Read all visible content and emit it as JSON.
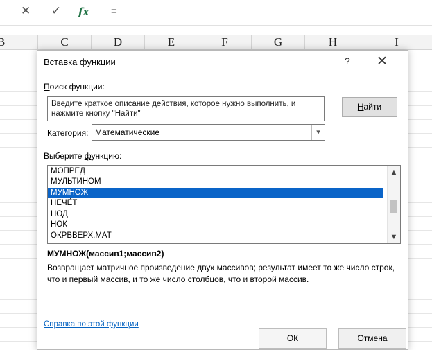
{
  "formula_bar": {
    "cancel_icon": "✕",
    "enter_icon": "✓",
    "fx_label": "fx",
    "formula": "="
  },
  "columns": [
    "B",
    "C",
    "D",
    "E",
    "F",
    "G",
    "H",
    "I"
  ],
  "dialog": {
    "title": "Вставка функции",
    "help_label": "?",
    "close_label": "✕",
    "search_label": "Поиск функции:",
    "search_text": "Введите краткое описание действия, которое нужно выполнить, и нажмите кнопку \"Найти\"",
    "find_button": "Найти",
    "category_label": "Категория:",
    "category_value": "Математические",
    "select_label": "Выберите функцию:",
    "functions": [
      "МОПРЕД",
      "МУЛЬТИНОМ",
      "МУМНОЖ",
      "НЕЧЁТ",
      "НОД",
      "НОК",
      "ОКРВВЕРХ.МАТ"
    ],
    "selected_function": "МУМНОЖ",
    "signature": "МУМНОЖ(массив1;массив2)",
    "description": "Возвращает матричное произведение двух массивов; результат имеет то же число строк, что и первый массив, и то же число столбцов, что и второй массив.",
    "help_link": "Справка по этой функции",
    "ok_button": "ОК",
    "cancel_button": "Отмена"
  }
}
